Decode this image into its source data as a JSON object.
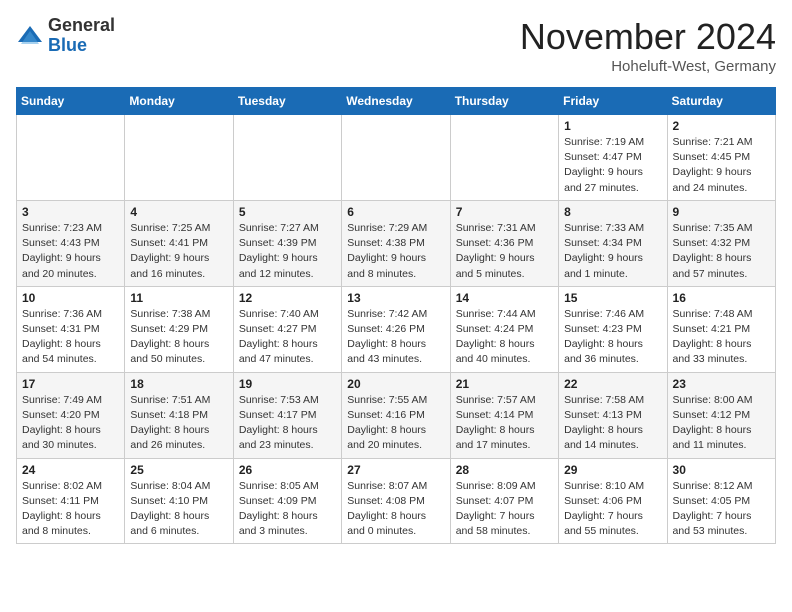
{
  "logo": {
    "text_general": "General",
    "text_blue": "Blue"
  },
  "header": {
    "month": "November 2024",
    "location": "Hoheluft-West, Germany"
  },
  "days_of_week": [
    "Sunday",
    "Monday",
    "Tuesday",
    "Wednesday",
    "Thursday",
    "Friday",
    "Saturday"
  ],
  "weeks": [
    [
      {
        "day": "",
        "info": ""
      },
      {
        "day": "",
        "info": ""
      },
      {
        "day": "",
        "info": ""
      },
      {
        "day": "",
        "info": ""
      },
      {
        "day": "",
        "info": ""
      },
      {
        "day": "1",
        "info": "Sunrise: 7:19 AM\nSunset: 4:47 PM\nDaylight: 9 hours and 27 minutes."
      },
      {
        "day": "2",
        "info": "Sunrise: 7:21 AM\nSunset: 4:45 PM\nDaylight: 9 hours and 24 minutes."
      }
    ],
    [
      {
        "day": "3",
        "info": "Sunrise: 7:23 AM\nSunset: 4:43 PM\nDaylight: 9 hours and 20 minutes."
      },
      {
        "day": "4",
        "info": "Sunrise: 7:25 AM\nSunset: 4:41 PM\nDaylight: 9 hours and 16 minutes."
      },
      {
        "day": "5",
        "info": "Sunrise: 7:27 AM\nSunset: 4:39 PM\nDaylight: 9 hours and 12 minutes."
      },
      {
        "day": "6",
        "info": "Sunrise: 7:29 AM\nSunset: 4:38 PM\nDaylight: 9 hours and 8 minutes."
      },
      {
        "day": "7",
        "info": "Sunrise: 7:31 AM\nSunset: 4:36 PM\nDaylight: 9 hours and 5 minutes."
      },
      {
        "day": "8",
        "info": "Sunrise: 7:33 AM\nSunset: 4:34 PM\nDaylight: 9 hours and 1 minute."
      },
      {
        "day": "9",
        "info": "Sunrise: 7:35 AM\nSunset: 4:32 PM\nDaylight: 8 hours and 57 minutes."
      }
    ],
    [
      {
        "day": "10",
        "info": "Sunrise: 7:36 AM\nSunset: 4:31 PM\nDaylight: 8 hours and 54 minutes."
      },
      {
        "day": "11",
        "info": "Sunrise: 7:38 AM\nSunset: 4:29 PM\nDaylight: 8 hours and 50 minutes."
      },
      {
        "day": "12",
        "info": "Sunrise: 7:40 AM\nSunset: 4:27 PM\nDaylight: 8 hours and 47 minutes."
      },
      {
        "day": "13",
        "info": "Sunrise: 7:42 AM\nSunset: 4:26 PM\nDaylight: 8 hours and 43 minutes."
      },
      {
        "day": "14",
        "info": "Sunrise: 7:44 AM\nSunset: 4:24 PM\nDaylight: 8 hours and 40 minutes."
      },
      {
        "day": "15",
        "info": "Sunrise: 7:46 AM\nSunset: 4:23 PM\nDaylight: 8 hours and 36 minutes."
      },
      {
        "day": "16",
        "info": "Sunrise: 7:48 AM\nSunset: 4:21 PM\nDaylight: 8 hours and 33 minutes."
      }
    ],
    [
      {
        "day": "17",
        "info": "Sunrise: 7:49 AM\nSunset: 4:20 PM\nDaylight: 8 hours and 30 minutes."
      },
      {
        "day": "18",
        "info": "Sunrise: 7:51 AM\nSunset: 4:18 PM\nDaylight: 8 hours and 26 minutes."
      },
      {
        "day": "19",
        "info": "Sunrise: 7:53 AM\nSunset: 4:17 PM\nDaylight: 8 hours and 23 minutes."
      },
      {
        "day": "20",
        "info": "Sunrise: 7:55 AM\nSunset: 4:16 PM\nDaylight: 8 hours and 20 minutes."
      },
      {
        "day": "21",
        "info": "Sunrise: 7:57 AM\nSunset: 4:14 PM\nDaylight: 8 hours and 17 minutes."
      },
      {
        "day": "22",
        "info": "Sunrise: 7:58 AM\nSunset: 4:13 PM\nDaylight: 8 hours and 14 minutes."
      },
      {
        "day": "23",
        "info": "Sunrise: 8:00 AM\nSunset: 4:12 PM\nDaylight: 8 hours and 11 minutes."
      }
    ],
    [
      {
        "day": "24",
        "info": "Sunrise: 8:02 AM\nSunset: 4:11 PM\nDaylight: 8 hours and 8 minutes."
      },
      {
        "day": "25",
        "info": "Sunrise: 8:04 AM\nSunset: 4:10 PM\nDaylight: 8 hours and 6 minutes."
      },
      {
        "day": "26",
        "info": "Sunrise: 8:05 AM\nSunset: 4:09 PM\nDaylight: 8 hours and 3 minutes."
      },
      {
        "day": "27",
        "info": "Sunrise: 8:07 AM\nSunset: 4:08 PM\nDaylight: 8 hours and 0 minutes."
      },
      {
        "day": "28",
        "info": "Sunrise: 8:09 AM\nSunset: 4:07 PM\nDaylight: 7 hours and 58 minutes."
      },
      {
        "day": "29",
        "info": "Sunrise: 8:10 AM\nSunset: 4:06 PM\nDaylight: 7 hours and 55 minutes."
      },
      {
        "day": "30",
        "info": "Sunrise: 8:12 AM\nSunset: 4:05 PM\nDaylight: 7 hours and 53 minutes."
      }
    ]
  ]
}
